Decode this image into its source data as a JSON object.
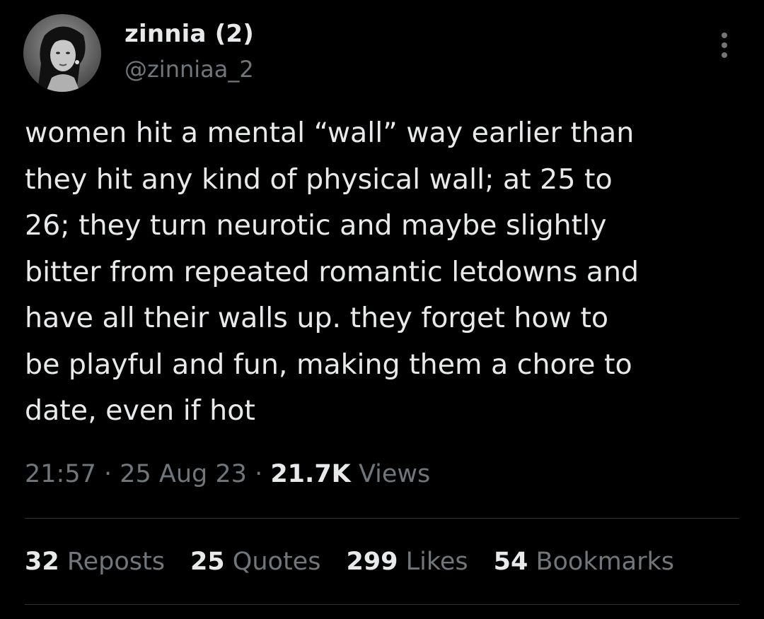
{
  "author": {
    "display_name": "zinnia (2)",
    "handle": "@zinniaa_2",
    "avatar_icon": "profile-photo"
  },
  "more_icon": "more-vertical-icon",
  "tweet": {
    "text": "women hit a mental “wall” way earlier than\nthey hit any kind of physical wall; at 25 to\n26; they turn neurotic and maybe slightly\nbitter from repeated romantic letdowns and\nhave all their walls up. they forget how to\nbe playful and fun, making them a chore to\ndate, even if hot"
  },
  "meta": {
    "time": "21:57",
    "separator": " · ",
    "date": "25 Aug 23",
    "views_count": "21.7K",
    "views_label": " Views"
  },
  "stats": {
    "reposts": {
      "count": "32",
      "label": " Reposts"
    },
    "quotes": {
      "count": "25",
      "label": " Quotes"
    },
    "likes": {
      "count": "299",
      "label": " Likes"
    },
    "bookmarks": {
      "count": "54",
      "label": " Bookmarks"
    }
  },
  "colors": {
    "background": "#000000",
    "primary_text": "#e7e9ea",
    "secondary_text": "#71767b",
    "divider": "#2f3336"
  }
}
